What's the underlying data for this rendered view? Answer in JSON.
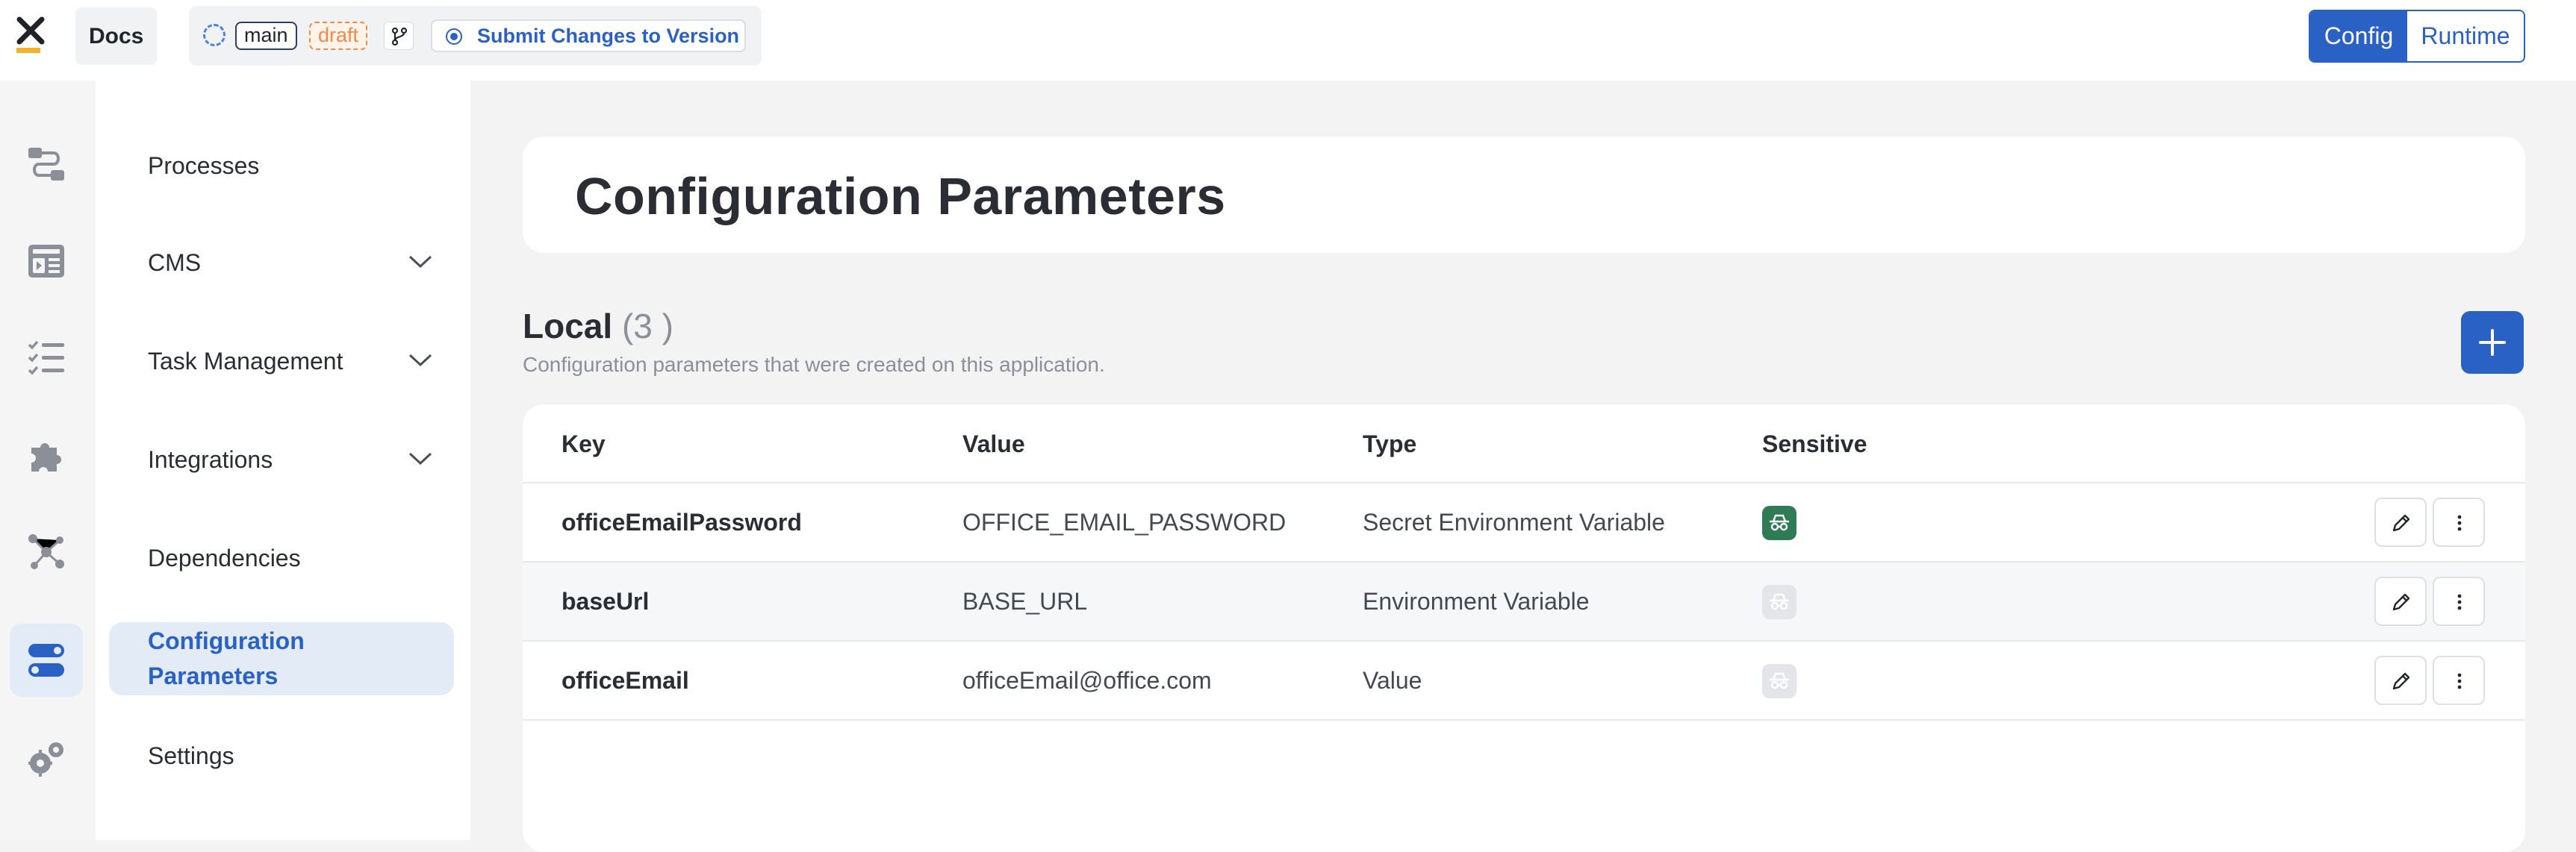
{
  "header": {
    "app_name": "Docs",
    "branch": "main",
    "status": "draft",
    "submit_label": "Submit Changes to Version",
    "mode_config": "Config",
    "mode_runtime": "Runtime"
  },
  "rail": {
    "icons": [
      "processes-icon",
      "cms-icon",
      "task-management-icon",
      "integrations-icon",
      "dependencies-icon",
      "configuration-parameters-icon",
      "settings-icon"
    ],
    "active_index": 5
  },
  "nav": {
    "items": [
      {
        "label": "Processes",
        "expandable": false
      },
      {
        "label": "CMS",
        "expandable": true
      },
      {
        "label": "Task Management",
        "expandable": true
      },
      {
        "label": "Integrations",
        "expandable": true
      },
      {
        "label": "Dependencies",
        "expandable": false
      },
      {
        "label": "Configuration\nParameters",
        "expandable": false,
        "active": true
      },
      {
        "label": "Settings",
        "expandable": false
      }
    ]
  },
  "page": {
    "title": "Configuration Parameters"
  },
  "local": {
    "title": "Local",
    "count": "(3 )",
    "description": "Configuration parameters that were created on this application.",
    "columns": [
      "Key",
      "Value",
      "Type",
      "Sensitive"
    ],
    "rows": [
      {
        "key": "officeEmailPassword",
        "value": "OFFICE_EMAIL_PASSWORD",
        "type": "Secret Environment Variable",
        "sensitive": true
      },
      {
        "key": "baseUrl",
        "value": "BASE_URL",
        "type": "Environment Variable",
        "sensitive": false
      },
      {
        "key": "officeEmail",
        "value": "officeEmail@office.com",
        "type": "Value",
        "sensitive": false
      }
    ]
  },
  "colors": {
    "accent": "#2a61c4",
    "active_bg": "#e3ebf7",
    "sensitive_on": "#2f7b55",
    "draft": "#f08a4b"
  }
}
